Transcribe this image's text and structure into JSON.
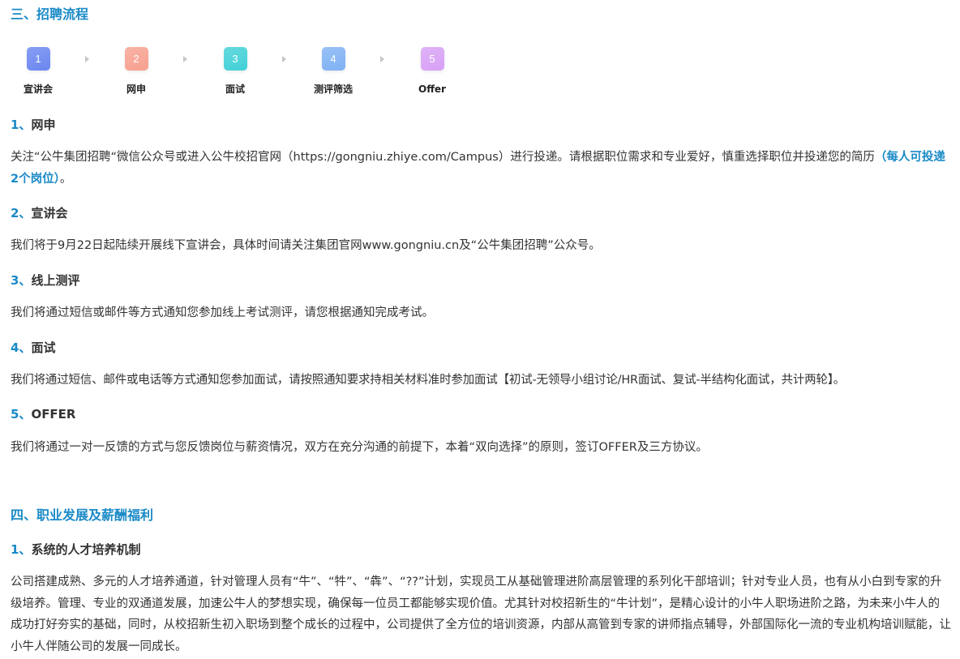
{
  "section3": {
    "title": "三、招聘流程",
    "steps": [
      {
        "number": "1",
        "label": "宣讲会",
        "color": "#6a86f0"
      },
      {
        "number": "2",
        "label": "网申",
        "color": "#f7a08f"
      },
      {
        "number": "3",
        "label": "面试",
        "color": "#3fd0d6"
      },
      {
        "number": "4",
        "label": "测评筛选",
        "color": "#7fb1f4"
      },
      {
        "number": "5",
        "label": "Offer",
        "color": "#d7a0f5"
      }
    ],
    "items": [
      {
        "num": "1、",
        "title": "网申",
        "text_before": "关注“公牛集团招聘“微信公众号或进入公牛校招官网（https://gongniu.zhiye.com/Campus）进行投递。请根据职位需求和专业爱好，慎重选择职位并投递您的简历",
        "highlight": "（每人可投递2个岗位）",
        "text_after": "。"
      },
      {
        "num": "2、",
        "title": "宣讲会",
        "text": "我们将于9月22日起陆续开展线下宣讲会，具体时间请关注集团官网www.gongniu.cn及“公牛集团招聘”公众号。"
      },
      {
        "num": "3、",
        "title": "线上测评",
        "text": "我们将通过短信或邮件等方式通知您参加线上考试测评，请您根据通知完成考试。"
      },
      {
        "num": "4、",
        "title": "面试",
        "text": "我们将通过短信、邮件或电话等方式通知您参加面试，请按照通知要求持相关材料准时参加面试【初试-无领导小组讨论/HR面试、复试-半结构化面试，共计两轮】。"
      },
      {
        "num": "5、",
        "title": "OFFER",
        "text": "我们将通过一对一反馈的方式与您反馈岗位与薪资情况，双方在充分沟通的前提下，本着“双向选择”的原则，签订OFFER及三方协议。"
      }
    ]
  },
  "section4": {
    "title": "四、职业发展及薪酬福利",
    "items": [
      {
        "num": "1、",
        "title": "系统的人才培养机制",
        "text": "公司搭建成熟、多元的人才培养通道，针对管理人员有“牛”、“牪”、“犇”、“??”计划，实现员工从基础管理进阶高层管理的系列化干部培训；针对专业人员，也有从小白到专家的升级培养。管理、专业的双通道发展，加速公牛人的梦想实现，确保每一位员工都能够实现价值。尤其针对校招新生的“牛计划”，是精心设计的小牛人职场进阶之路，为未来小牛人的成功打好夯实的基础，同时，从校招新生初入职场到整个成长的过程中，公司提供了全方位的培训资源，内部从高管到专家的讲师指点辅导，外部国际化一流的专业机构培训赋能，让小牛人伴随公司的发展一同成长。"
      }
    ]
  }
}
